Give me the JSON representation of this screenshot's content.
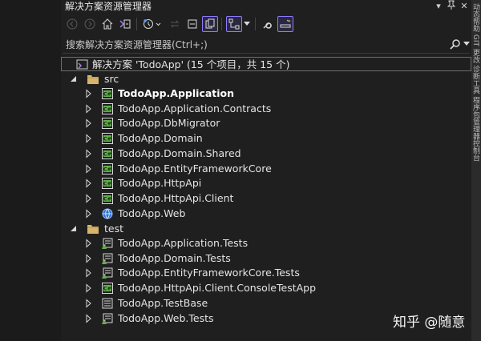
{
  "window": {
    "title": "解决方案资源管理器",
    "pin_glyph": "▾",
    "close_glyph": "✕"
  },
  "side_panel_text": "动态帮助 GIT 更改 诊断工具 程序包管理器控制台",
  "search": {
    "placeholder": "搜索解决方案资源管理器(Ctrl+;)"
  },
  "toolbar": {
    "buttons": [
      "back-icon",
      "forward-icon",
      "home-icon",
      "vs-switch-icon",
      "history-icon",
      "sync-icon",
      "collapse-icon",
      "show-all-files-icon",
      "view-options-icon",
      "properties-icon",
      "preview-icon"
    ]
  },
  "solution": {
    "label": "解决方案 'TodoApp' (15 个项目，共 15 个)"
  },
  "folders": {
    "src": "src",
    "test": "test"
  },
  "src_projects": [
    {
      "label": "TodoApp.Application",
      "bold": true,
      "icon": "csharp-project-icon"
    },
    {
      "label": "TodoApp.Application.Contracts",
      "icon": "csharp-project-icon"
    },
    {
      "label": "TodoApp.DbMigrator",
      "icon": "csharp-project-icon"
    },
    {
      "label": "TodoApp.Domain",
      "icon": "csharp-project-icon"
    },
    {
      "label": "TodoApp.Domain.Shared",
      "icon": "csharp-project-icon"
    },
    {
      "label": "TodoApp.EntityFrameworkCore",
      "icon": "csharp-project-icon"
    },
    {
      "label": "TodoApp.HttpApi",
      "icon": "csharp-project-icon"
    },
    {
      "label": "TodoApp.HttpApi.Client",
      "icon": "csharp-project-icon"
    },
    {
      "label": "TodoApp.Web",
      "icon": "web-project-icon"
    }
  ],
  "test_projects": [
    {
      "label": "TodoApp.Application.Tests",
      "icon": "test-project-icon"
    },
    {
      "label": "TodoApp.Domain.Tests",
      "icon": "test-project-icon"
    },
    {
      "label": "TodoApp.EntityFrameworkCore.Tests",
      "icon": "test-project-icon"
    },
    {
      "label": "TodoApp.HttpApi.Client.ConsoleTestApp",
      "icon": "csharp-project-icon"
    },
    {
      "label": "TodoApp.TestBase",
      "icon": "library-project-icon"
    },
    {
      "label": "TodoApp.Web.Tests",
      "icon": "test-project-icon"
    }
  ],
  "watermark": "知乎 @随意",
  "colors": {
    "background": "#1f1f1f",
    "accent": "#8f7bff",
    "csharp_green": "#5fb04a",
    "folder": "#d7b46a"
  }
}
